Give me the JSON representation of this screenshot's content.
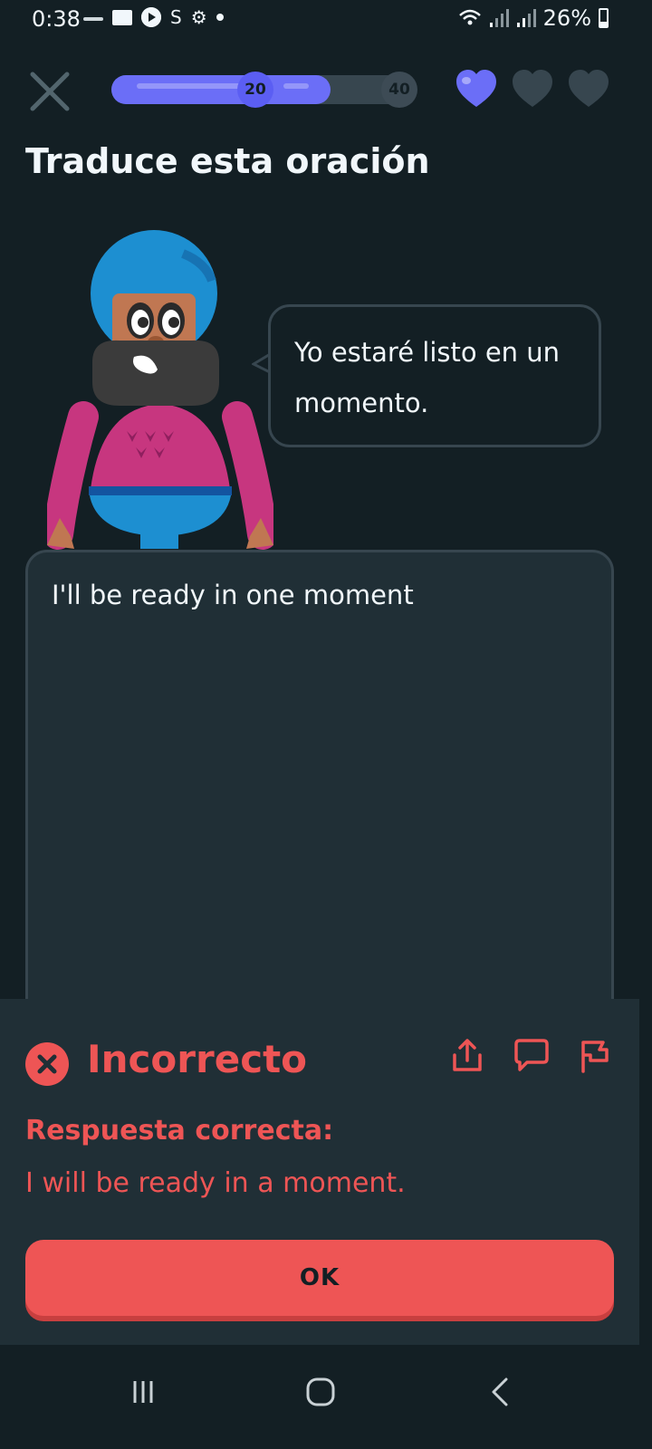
{
  "status_bar": {
    "time": "0:38",
    "battery": "26%"
  },
  "header": {
    "progress_percent": 72,
    "milestones": [
      "20",
      "40"
    ],
    "hearts_total": 3,
    "hearts_active": 1,
    "accent_color": "#6b6ef7"
  },
  "instruction": "Traduce esta oración",
  "prompt": {
    "sentence": "Yo estaré listo en un momento."
  },
  "answer": {
    "value": "I'll be ready in one moment"
  },
  "feedback": {
    "title": "Incorrecto",
    "correct_label": "Respuesta correcta:",
    "correct_answer": "I will be ready in a moment.",
    "color": "#ee5555"
  },
  "ok_button": {
    "label": "OK"
  },
  "icons": {
    "close": "close-icon",
    "heart": "heart-icon",
    "share": "share-icon",
    "comment": "comment-icon",
    "flag": "flag-icon",
    "recent_apps": "recent-apps-icon",
    "home": "home-icon",
    "back": "back-icon"
  }
}
